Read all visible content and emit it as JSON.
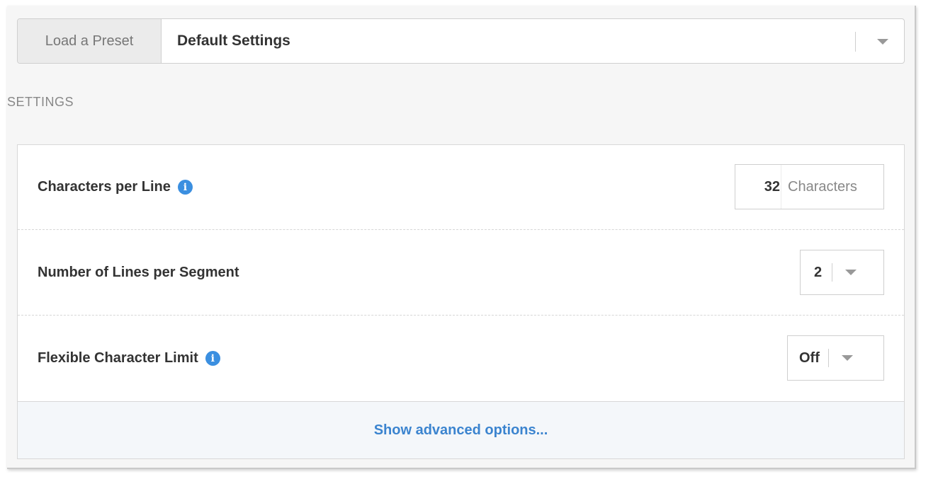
{
  "preset": {
    "button_label": "Load a Preset",
    "selected_value": "Default Settings"
  },
  "section": {
    "heading": "SETTINGS"
  },
  "settings": {
    "chars_per_line": {
      "label": "Characters per Line",
      "value": "32",
      "unit": "Characters",
      "info_icon": "info-icon"
    },
    "lines_per_segment": {
      "label": "Number of Lines per Segment",
      "value": "2"
    },
    "flexible_limit": {
      "label": "Flexible Character Limit",
      "value": "Off",
      "info_icon": "info-icon"
    }
  },
  "advanced": {
    "label": "Show advanced options..."
  },
  "colors": {
    "accent": "#3b84cf",
    "info_icon": "#3b8fe0",
    "panel_background": "#f6f6f6"
  }
}
